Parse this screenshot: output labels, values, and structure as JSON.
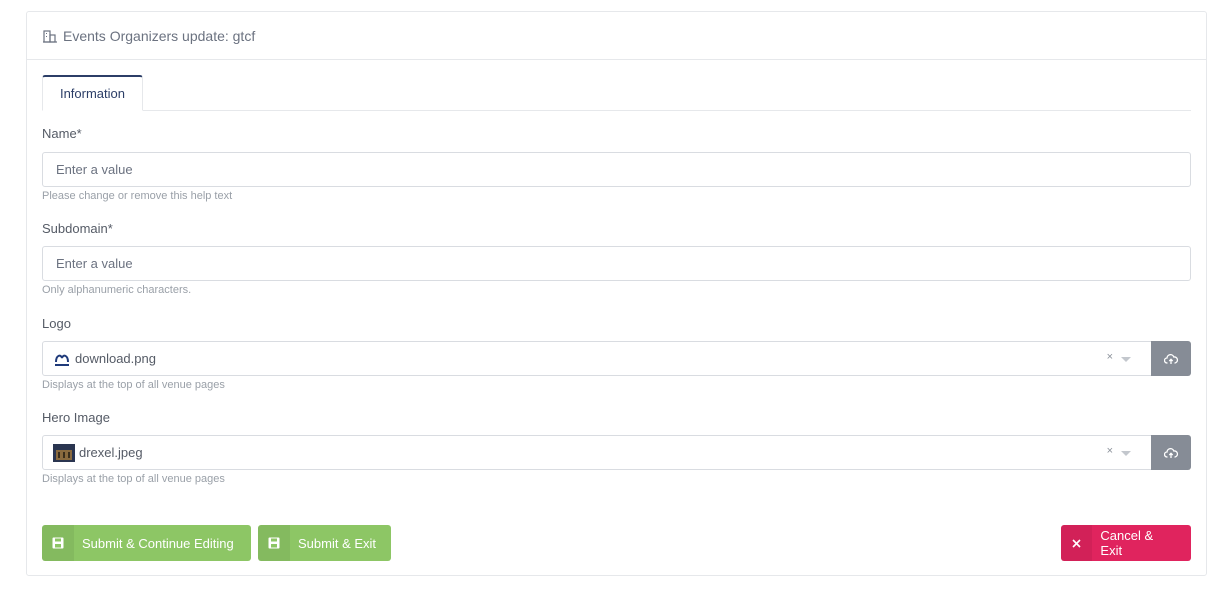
{
  "header": {
    "title": "Events Organizers update: gtcf",
    "icon": "building-icon"
  },
  "tabs": [
    {
      "label": "Information",
      "active": true
    }
  ],
  "form": {
    "name": {
      "label": "Name*",
      "placeholder": "Enter a value",
      "value": "",
      "help": "Please change or remove this help text"
    },
    "subdomain": {
      "label": "Subdomain*",
      "placeholder": "Enter a value",
      "value": "",
      "help": "Only alphanumeric characters."
    },
    "logo": {
      "label": "Logo",
      "value": "download.png",
      "clear": "×",
      "help": "Displays at the top of all venue pages"
    },
    "hero_image": {
      "label": "Hero Image",
      "value": "drexel.jpeg",
      "clear": "×",
      "help": "Displays at the top of all venue pages"
    }
  },
  "buttons": {
    "submit_continue": "Submit & Continue Editing",
    "submit_exit": "Submit & Exit",
    "cancel_exit": "Cancel & Exit"
  },
  "colors": {
    "green": "#8dc665",
    "red": "#e0245e",
    "gray": "#868c96",
    "tab_accent": "#2c3e67"
  }
}
